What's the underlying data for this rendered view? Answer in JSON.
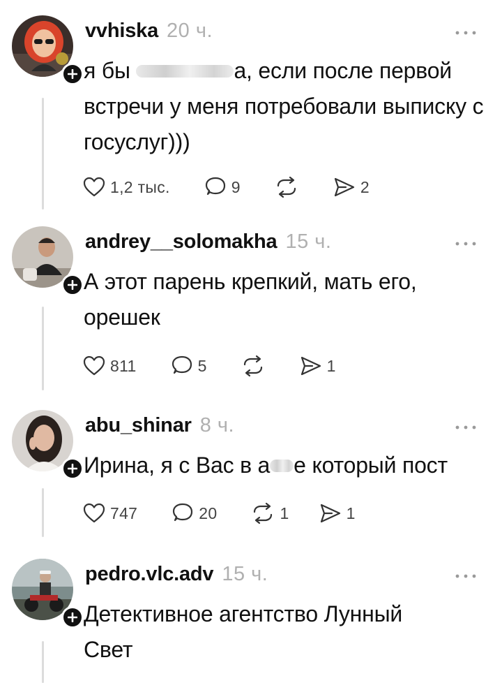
{
  "posts": [
    {
      "username": "vvhiska",
      "time": "20 ч.",
      "text_before_blur": "я бы ",
      "text_after_blur": "а, если после первой встречи у меня потребовали выписку с госуслуг)))",
      "likes": "1,2 тыс.",
      "replies": "9",
      "reposts": "",
      "shares": "2",
      "avatar_colors": {
        "bg": "#3a2e2a",
        "hair": "#d9442b",
        "face": "#f0c2a0"
      }
    },
    {
      "username": "andrey__solomakha",
      "time": "15 ч.",
      "text_before_blur": "А этот парень крепкий, мать его, орешек",
      "text_after_blur": "",
      "likes": "811",
      "replies": "5",
      "reposts": "",
      "shares": "1",
      "avatar_colors": {
        "bg": "#c9c4bd",
        "hair": "#2b2522",
        "face": "#c99a7d"
      }
    },
    {
      "username": "abu_shinar",
      "time": "8 ч.",
      "text_before_blur": "Ирина, я с Вас в а",
      "text_after_blur": "е который пост",
      "likes": "747",
      "replies": "20",
      "reposts": "1",
      "shares": "1",
      "avatar_colors": {
        "bg": "#d8d4d0",
        "hair": "#2a211d",
        "face": "#e0b9a2"
      }
    },
    {
      "username": "pedro.vlc.adv",
      "time": "15 ч.",
      "text_before_blur": "Детективное агентство Лунный Свет",
      "text_after_blur": "",
      "likes": "",
      "replies": "",
      "reposts": "",
      "shares": "",
      "avatar_colors": {
        "bg": "#7d8d8c",
        "hair": "#f2f2f2",
        "face": "#c7a58e"
      }
    }
  ],
  "icons": {
    "like": "heart-icon",
    "reply": "comment-icon",
    "repost": "repost-icon",
    "share": "share-icon",
    "more": "more-dots-icon",
    "follow": "plus-icon"
  },
  "colors": {
    "text": "#111111",
    "muted": "#b0b0b0",
    "thread": "#dcdcdc"
  }
}
